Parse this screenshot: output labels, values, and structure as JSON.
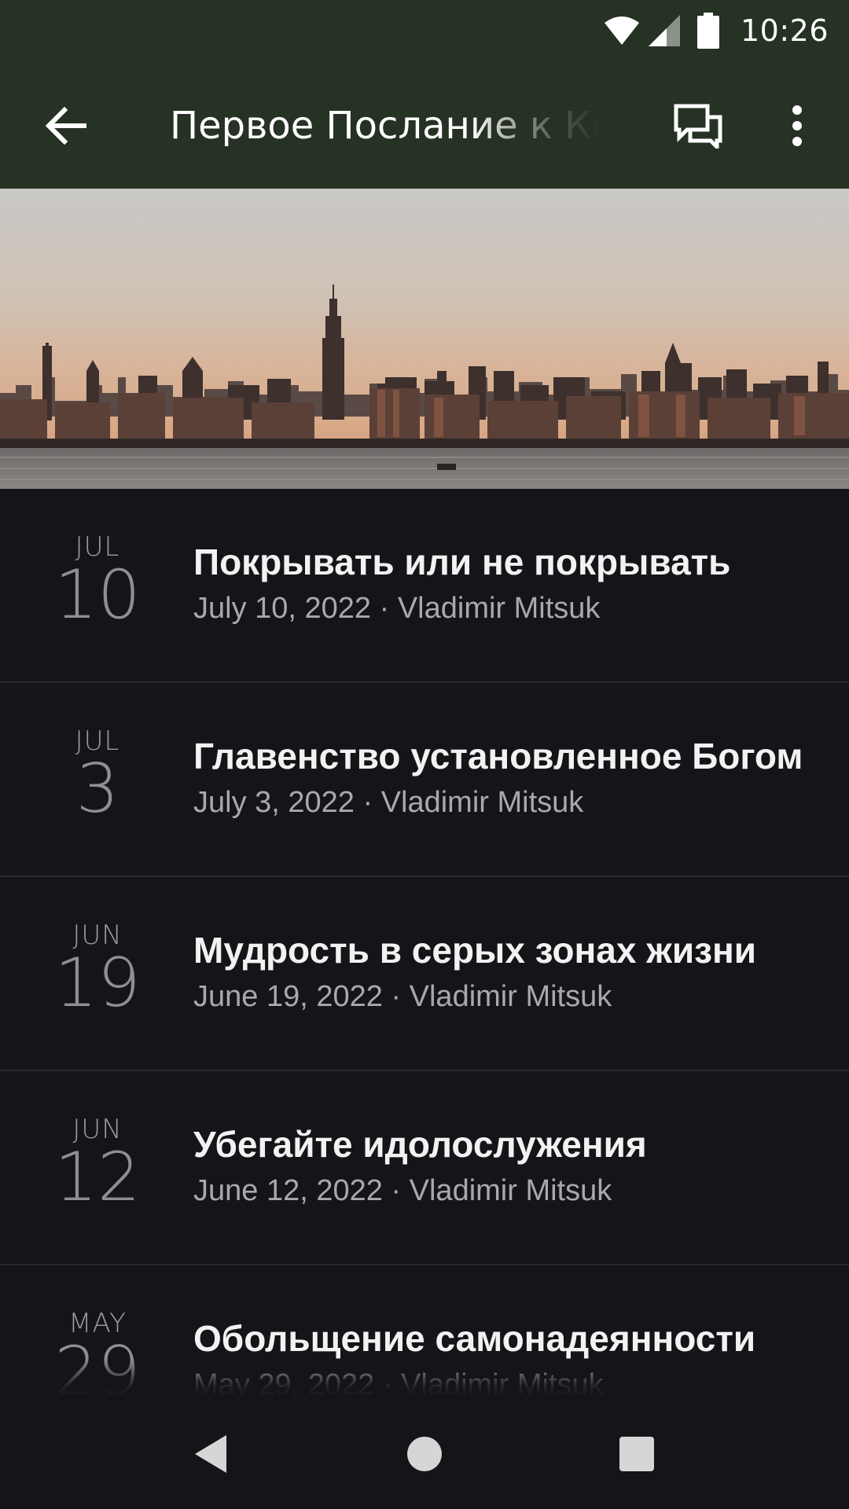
{
  "status_bar": {
    "time": "10:26",
    "icons": [
      "wifi-icon",
      "cellular-signal-icon",
      "battery-icon"
    ]
  },
  "toolbar": {
    "title": "Первое Послание к Коринфянам",
    "back_icon": "arrow-back-icon",
    "chat_icon": "chat-bubbles-icon",
    "more_icon": "more-vertical-icon",
    "background": "#263223"
  },
  "banner": {
    "image": "city-skyline-at-dusk"
  },
  "sermons": [
    {
      "month": "JUL",
      "day": "10",
      "title": "Покрывать или не покрывать",
      "meta": "July 10, 2022 · Vladimir Mitsuk"
    },
    {
      "month": "JUL",
      "day": "3",
      "title": "Главенство установленное Богом",
      "meta": "July 3, 2022 · Vladimir Mitsuk"
    },
    {
      "month": "JUN",
      "day": "19",
      "title": "Мудрость в серых зонах жизни",
      "meta": "June 19, 2022 · Vladimir Mitsuk"
    },
    {
      "month": "JUN",
      "day": "12",
      "title": "Убегайте идолослужения",
      "meta": "June 12, 2022 · Vladimir Mitsuk"
    },
    {
      "month": "MAY",
      "day": "29",
      "title": "Обольщение самонадеянности",
      "meta": "May 29, 2022 · Vladimir Mitsuk"
    }
  ],
  "nav_bar": {
    "icons": [
      "nav-back-icon",
      "nav-home-icon",
      "nav-recents-icon"
    ]
  }
}
